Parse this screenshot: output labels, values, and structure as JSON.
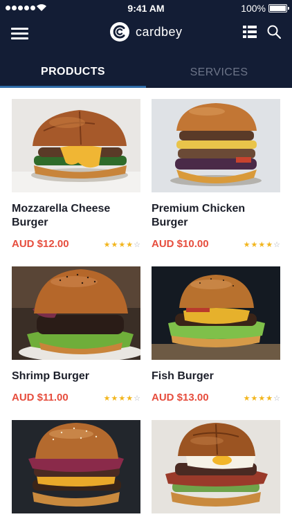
{
  "status": {
    "time": "9:41 AM",
    "battery": "100%"
  },
  "brand": {
    "name": "cardbey"
  },
  "tabs": [
    {
      "label": "PRODUCTS",
      "active": true
    },
    {
      "label": "SERVICES",
      "active": false
    }
  ],
  "colors": {
    "header": "#131d35",
    "price": "#e64d3d",
    "star": "#f2b51c",
    "active_tab_underline": "#2f6ca8"
  },
  "products": [
    {
      "name": "Mozzarella Cheese Burger",
      "price": "AUD $12.00",
      "rating": 4,
      "max_rating": 5
    },
    {
      "name": "Premium Chicken Burger",
      "price": "AUD $10.00",
      "rating": 4,
      "max_rating": 5
    },
    {
      "name": "Shrimp Burger",
      "price": "AUD $11.00",
      "rating": 4,
      "max_rating": 5
    },
    {
      "name": "Fish Burger",
      "price": "AUD $13.00",
      "rating": 4,
      "max_rating": 5
    },
    {
      "name": "",
      "price": "",
      "rating": 0,
      "max_rating": 0
    },
    {
      "name": "",
      "price": "",
      "rating": 0,
      "max_rating": 0
    }
  ],
  "icons": {
    "menu": "hamburger-menu-icon",
    "list": "list-view-icon",
    "search": "search-icon"
  }
}
